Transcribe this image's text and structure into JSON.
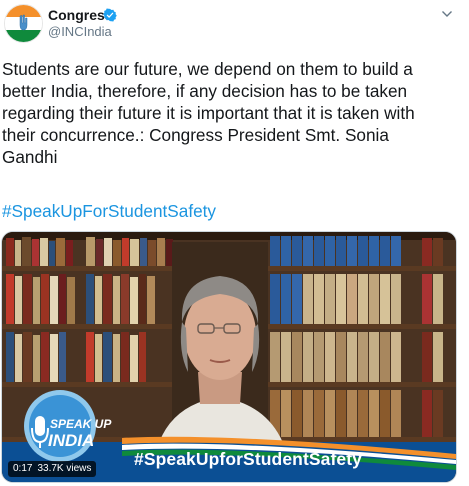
{
  "account": {
    "name": "Congress",
    "handle": "@INCIndia"
  },
  "tweet": {
    "lines": [
      "Students are our future, we depend on them to build a",
      "better India, therefore, if any decision has to be taken",
      "regarding their future it is important that it is taken with",
      "their concurrence.: Congress President Smt. Sonia",
      "Gandhi"
    ],
    "hashtag": "#SpeakUpForStudentSafety"
  },
  "video": {
    "logo_line1": "SPEAK UP",
    "logo_line2": "INDIA",
    "overlay_hashtag": "#SpeakUpforStudentSafety",
    "duration": "0:17",
    "views": "33.7K views"
  },
  "colors": {
    "link": "#1b95e0",
    "verified": "#1da1f2",
    "banner": "#0b4f94",
    "saffron": "#f4902b",
    "green": "#0f8a3c"
  },
  "icons": [
    "congress-logo-icon",
    "verified-icon",
    "chevron-down-icon",
    "microphone-icon"
  ]
}
